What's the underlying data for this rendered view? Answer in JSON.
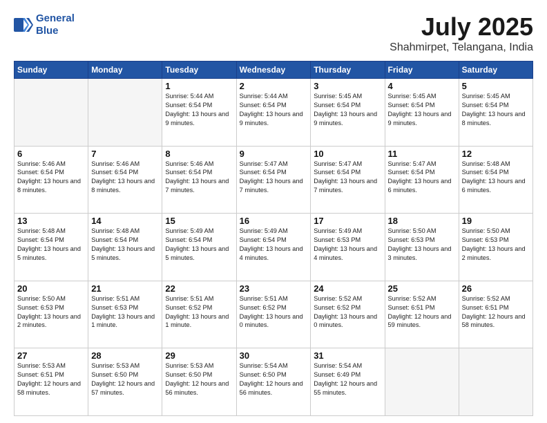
{
  "header": {
    "logo_line1": "General",
    "logo_line2": "Blue",
    "month": "July 2025",
    "location": "Shahmirpet, Telangana, India"
  },
  "days_of_week": [
    "Sunday",
    "Monday",
    "Tuesday",
    "Wednesday",
    "Thursday",
    "Friday",
    "Saturday"
  ],
  "weeks": [
    [
      {
        "day": "",
        "info": ""
      },
      {
        "day": "",
        "info": ""
      },
      {
        "day": "1",
        "info": "Sunrise: 5:44 AM\nSunset: 6:54 PM\nDaylight: 13 hours and 9 minutes."
      },
      {
        "day": "2",
        "info": "Sunrise: 5:44 AM\nSunset: 6:54 PM\nDaylight: 13 hours and 9 minutes."
      },
      {
        "day": "3",
        "info": "Sunrise: 5:45 AM\nSunset: 6:54 PM\nDaylight: 13 hours and 9 minutes."
      },
      {
        "day": "4",
        "info": "Sunrise: 5:45 AM\nSunset: 6:54 PM\nDaylight: 13 hours and 9 minutes."
      },
      {
        "day": "5",
        "info": "Sunrise: 5:45 AM\nSunset: 6:54 PM\nDaylight: 13 hours and 8 minutes."
      }
    ],
    [
      {
        "day": "6",
        "info": "Sunrise: 5:46 AM\nSunset: 6:54 PM\nDaylight: 13 hours and 8 minutes."
      },
      {
        "day": "7",
        "info": "Sunrise: 5:46 AM\nSunset: 6:54 PM\nDaylight: 13 hours and 8 minutes."
      },
      {
        "day": "8",
        "info": "Sunrise: 5:46 AM\nSunset: 6:54 PM\nDaylight: 13 hours and 7 minutes."
      },
      {
        "day": "9",
        "info": "Sunrise: 5:47 AM\nSunset: 6:54 PM\nDaylight: 13 hours and 7 minutes."
      },
      {
        "day": "10",
        "info": "Sunrise: 5:47 AM\nSunset: 6:54 PM\nDaylight: 13 hours and 7 minutes."
      },
      {
        "day": "11",
        "info": "Sunrise: 5:47 AM\nSunset: 6:54 PM\nDaylight: 13 hours and 6 minutes."
      },
      {
        "day": "12",
        "info": "Sunrise: 5:48 AM\nSunset: 6:54 PM\nDaylight: 13 hours and 6 minutes."
      }
    ],
    [
      {
        "day": "13",
        "info": "Sunrise: 5:48 AM\nSunset: 6:54 PM\nDaylight: 13 hours and 5 minutes."
      },
      {
        "day": "14",
        "info": "Sunrise: 5:48 AM\nSunset: 6:54 PM\nDaylight: 13 hours and 5 minutes."
      },
      {
        "day": "15",
        "info": "Sunrise: 5:49 AM\nSunset: 6:54 PM\nDaylight: 13 hours and 5 minutes."
      },
      {
        "day": "16",
        "info": "Sunrise: 5:49 AM\nSunset: 6:54 PM\nDaylight: 13 hours and 4 minutes."
      },
      {
        "day": "17",
        "info": "Sunrise: 5:49 AM\nSunset: 6:53 PM\nDaylight: 13 hours and 4 minutes."
      },
      {
        "day": "18",
        "info": "Sunrise: 5:50 AM\nSunset: 6:53 PM\nDaylight: 13 hours and 3 minutes."
      },
      {
        "day": "19",
        "info": "Sunrise: 5:50 AM\nSunset: 6:53 PM\nDaylight: 13 hours and 2 minutes."
      }
    ],
    [
      {
        "day": "20",
        "info": "Sunrise: 5:50 AM\nSunset: 6:53 PM\nDaylight: 13 hours and 2 minutes."
      },
      {
        "day": "21",
        "info": "Sunrise: 5:51 AM\nSunset: 6:53 PM\nDaylight: 13 hours and 1 minute."
      },
      {
        "day": "22",
        "info": "Sunrise: 5:51 AM\nSunset: 6:52 PM\nDaylight: 13 hours and 1 minute."
      },
      {
        "day": "23",
        "info": "Sunrise: 5:51 AM\nSunset: 6:52 PM\nDaylight: 13 hours and 0 minutes."
      },
      {
        "day": "24",
        "info": "Sunrise: 5:52 AM\nSunset: 6:52 PM\nDaylight: 13 hours and 0 minutes."
      },
      {
        "day": "25",
        "info": "Sunrise: 5:52 AM\nSunset: 6:51 PM\nDaylight: 12 hours and 59 minutes."
      },
      {
        "day": "26",
        "info": "Sunrise: 5:52 AM\nSunset: 6:51 PM\nDaylight: 12 hours and 58 minutes."
      }
    ],
    [
      {
        "day": "27",
        "info": "Sunrise: 5:53 AM\nSunset: 6:51 PM\nDaylight: 12 hours and 58 minutes."
      },
      {
        "day": "28",
        "info": "Sunrise: 5:53 AM\nSunset: 6:50 PM\nDaylight: 12 hours and 57 minutes."
      },
      {
        "day": "29",
        "info": "Sunrise: 5:53 AM\nSunset: 6:50 PM\nDaylight: 12 hours and 56 minutes."
      },
      {
        "day": "30",
        "info": "Sunrise: 5:54 AM\nSunset: 6:50 PM\nDaylight: 12 hours and 56 minutes."
      },
      {
        "day": "31",
        "info": "Sunrise: 5:54 AM\nSunset: 6:49 PM\nDaylight: 12 hours and 55 minutes."
      },
      {
        "day": "",
        "info": ""
      },
      {
        "day": "",
        "info": ""
      }
    ]
  ]
}
